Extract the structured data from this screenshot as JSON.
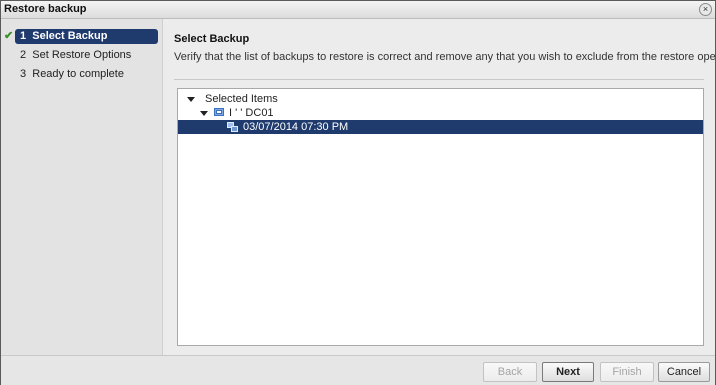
{
  "window": {
    "title": "Restore backup",
    "close_glyph": "×"
  },
  "steps": [
    {
      "number": "1",
      "label": "Select Backup",
      "state": "active",
      "completed_glyph": "✔"
    },
    {
      "number": "2",
      "label": "Set Restore Options",
      "state": "pending"
    },
    {
      "number": "3",
      "label": "Ready to complete",
      "state": "pending"
    }
  ],
  "main": {
    "heading": "Select Backup",
    "description": "Verify that the list of backups to restore is correct and remove any that you wish to exclude from the restore operation.",
    "tree": {
      "root_label": "Selected Items",
      "vm_label": "I     ' ' DC01",
      "backup_label": "03/07/2014 07:30 PM"
    }
  },
  "footer": {
    "back_label": "Back",
    "next_label": "Next",
    "finish_label": "Finish",
    "cancel_label": "Cancel"
  },
  "colors": {
    "selection": "#1f3a6d",
    "check": "#3a8f2a",
    "icon_blue": "#3b6fc2"
  },
  "icons": {
    "close": "close-icon",
    "check": "checkmark-icon",
    "expand": "caret-down-icon",
    "vm": "virtual-machine-icon",
    "backup": "backup-snapshot-icon"
  }
}
